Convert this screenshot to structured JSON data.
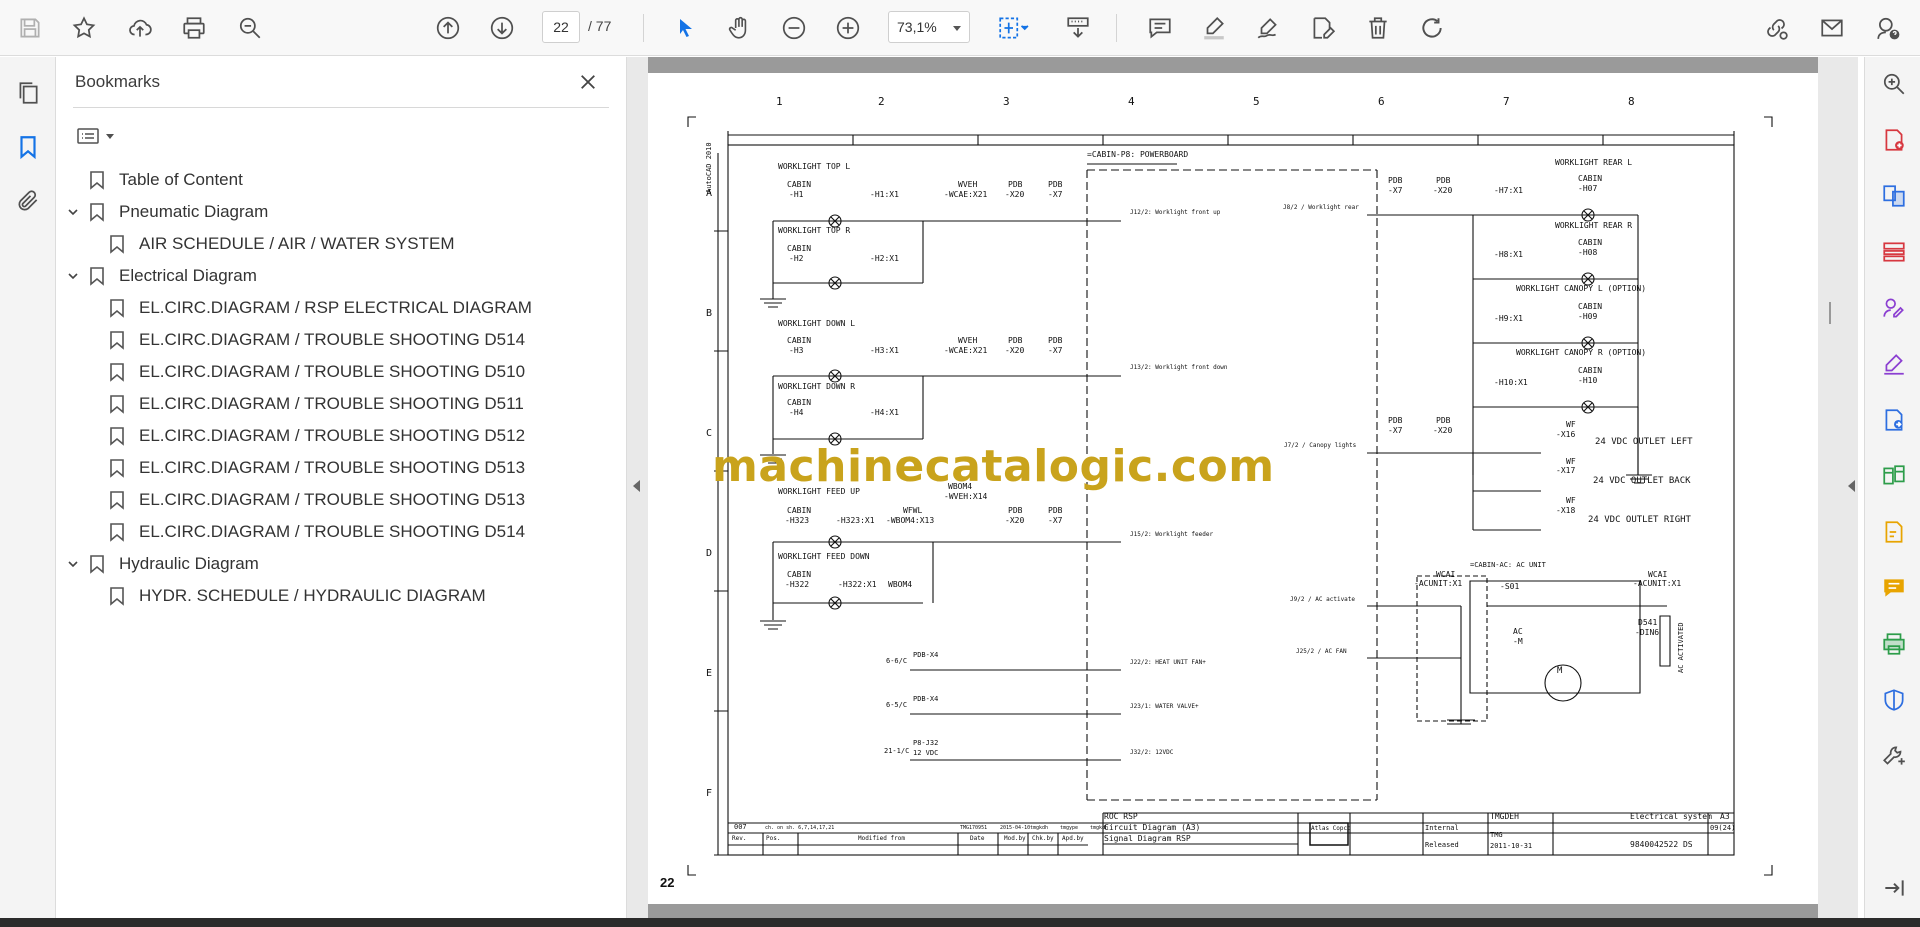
{
  "toolbar": {
    "save_icon": "save-icon",
    "current_page": "22",
    "total_pages": "/ 77",
    "zoom": "73,1%"
  },
  "bookmarks": {
    "title": "Bookmarks",
    "items": [
      {
        "label": "Table of Content",
        "level": 0,
        "expandable": false
      },
      {
        "label": "Pneumatic Diagram",
        "level": 0,
        "expandable": true
      },
      {
        "label": "AIR SCHEDULE / AIR / WATER SYSTEM",
        "level": 1,
        "expandable": false
      },
      {
        "label": "Electrical Diagram",
        "level": 0,
        "expandable": true
      },
      {
        "label": "EL.CIRC.DIAGRAM / RSP ELECTRICAL DIAGRAM",
        "level": 1,
        "expandable": false
      },
      {
        "label": "EL.CIRC.DIAGRAM / TROUBLE SHOOTING D514",
        "level": 1,
        "expandable": false
      },
      {
        "label": "EL.CIRC.DIAGRAM / TROUBLE SHOOTING D510",
        "level": 1,
        "expandable": false
      },
      {
        "label": "EL.CIRC.DIAGRAM / TROUBLE SHOOTING D511",
        "level": 1,
        "expandable": false
      },
      {
        "label": "EL.CIRC.DIAGRAM / TROUBLE SHOOTING D512",
        "level": 1,
        "expandable": false
      },
      {
        "label": "EL.CIRC.DIAGRAM / TROUBLE SHOOTING D513",
        "level": 1,
        "expandable": false
      },
      {
        "label": "EL.CIRC.DIAGRAM / TROUBLE SHOOTING D513",
        "level": 1,
        "expandable": false
      },
      {
        "label": "EL.CIRC.DIAGRAM / TROUBLE SHOOTING D514",
        "level": 1,
        "expandable": false
      },
      {
        "label": "Hydraulic Diagram",
        "level": 0,
        "expandable": true
      },
      {
        "label": "HYDR. SCHEDULE / HYDRAULIC DIAGRAM",
        "level": 1,
        "expandable": false
      }
    ]
  },
  "document": {
    "page_label": "22",
    "watermark": "machinecatalogic.com",
    "columns": [
      "1",
      "2",
      "3",
      "4",
      "5",
      "6",
      "7",
      "8"
    ],
    "rows": [
      "A",
      "B",
      "C",
      "D",
      "E",
      "F"
    ],
    "side_label": "AutoCAD 2010",
    "powerboard": "=CABIN-P8: POWERBOARD",
    "worklight_top_l": "WORKLIGHT TOP L",
    "worklight_top_r": "WORKLIGHT TOP R",
    "worklight_down_l": "WORKLIGHT DOWN L",
    "worklight_down_r": "WORKLIGHT DOWN R",
    "worklight_feed_up": "WORKLIGHT FEED UP",
    "worklight_feed_down": "WORKLIGHT FEED DOWN",
    "worklight_rear_l": "WORKLIGHT REAR L",
    "worklight_rear_r": "WORKLIGHT REAR R",
    "worklight_canopy_l": "WORKLIGHT CANOPY L (OPTION)",
    "worklight_canopy_r": "WORKLIGHT CANOPY R (OPTION)",
    "cabin": "CABIN",
    "h1": "-H1",
    "h2": "-H2",
    "h3": "-H3",
    "h4": "-H4",
    "h323": "-H323",
    "h322": "-H322",
    "h07": "-H07",
    "h08": "-H08",
    "h09": "-H09",
    "h10": "-H10",
    "h1x1": "-H1:X1",
    "h2x1": "-H2:X1",
    "h3x1": "-H3:X1",
    "h4x1": "-H4:X1",
    "h323x1": "-H323:X1",
    "h322x1": "-H322:X1",
    "h7x1": "-H7:X1",
    "h8x1": "-H8:X1",
    "h9x1": "-H9:X1",
    "h10x1": "-H10:X1",
    "wveh": "WVEH",
    "wcae21": "-WCAE:X21",
    "wbom4": "WBOM4",
    "wveh14": "-WVEH:X14",
    "wfwl": "WFWL",
    "wbom13": "-WBOM4:X13",
    "pdb": "PDB",
    "x20": "-X20",
    "x7": "-X7",
    "j12": "J12/2: Worklight front up",
    "j13": "J13/2: Worklight front down",
    "j15": "J15/2: Worklight feeder",
    "j22": "J22/2: HEAT UNIT FAN+",
    "j23": "J23/1: WATER VALVE+",
    "j32": "J32/2: 12VDC",
    "j8": "J8/2 / Worklight rear",
    "j7": "J7/2 / Canopy lights",
    "j9": "J9/2 / AC activate",
    "j25": "J25/2 / AC FAN",
    "pdbx4": "PDB-X4",
    "ref1": "6-6/C",
    "ref2": "6-5/C",
    "ref3": "21-1/C",
    "p8j32": "P8-J32",
    "vdc12": "12 VDC",
    "wf": "WF",
    "x16": "-X16",
    "x17": "-X17",
    "x18": "-X18",
    "outlet_left": "24 VDC OUTLET LEFT",
    "outlet_back": "24 VDC OUTLET BACK",
    "outlet_right": "24 VDC OUTLET RIGHT",
    "ac_unit": "=CABIN-AC: AC UNIT",
    "wcai": "WCAI",
    "acunit": "-ACUNIT:X1",
    "s01": "-S01",
    "ac": "AC",
    "acm": "-M",
    "motor": "M",
    "d541": "D541",
    "din6": "-DIN6",
    "ac_activated": "AC ACTIVATED",
    "tb_desc1": "ROC RSP",
    "tb_desc2": "Circuit Diagram (A3)",
    "tb_desc3": "Signal Diagram RSP",
    "tb_drawn": "TMGDEH",
    "tb_checked": "TMG",
    "tb_date": "2011-10-31",
    "tb_internal": "Internal",
    "tb_released": "Released",
    "tb_system": "Electrical system",
    "tb_size": "A3",
    "tb_sheet": "09(24)",
    "tb_docno": "9840042522 DS",
    "tb_rev": "007",
    "tb_mod": "ch. on sh. 6,7,14,17,21",
    "tb_ecn": "TMG170951",
    "tb_date2": "2015-04-10",
    "tb_person": "tmgkdh",
    "tb_person2": "tmgype",
    "tb_h_rev": "Rev.",
    "tb_h_pos": "Pos.",
    "tb_h_modfrom": "Modified from",
    "tb_h_date": "Date",
    "tb_h_modby": "Mod.by",
    "tb_h_chkby": "Chk.by",
    "tb_h_apdby": "Apd.by",
    "tb_logo": "Atlas Copco"
  },
  "colors": {
    "accent": "#1473e6",
    "watermark": "#c9a31c",
    "icon": "#505050",
    "red": "#d7373f",
    "blue": "#2d6ee0",
    "purple": "#8b3fd1",
    "green": "#2d9d4a",
    "yellow": "#e8a400"
  }
}
